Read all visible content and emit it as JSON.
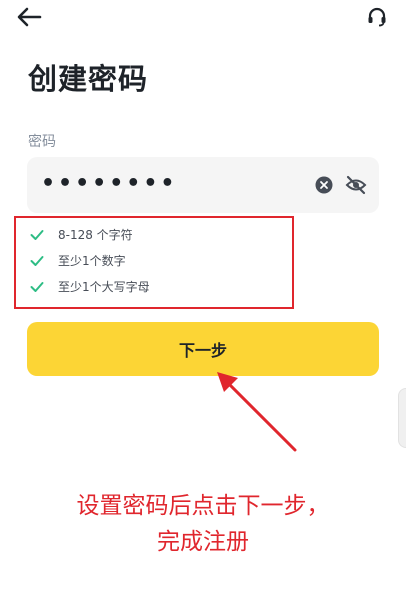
{
  "header": {
    "back_icon": "arrow-left-icon",
    "support_icon": "headset-icon"
  },
  "page": {
    "title": "创建密码"
  },
  "password_field": {
    "label": "密码",
    "value": "••••••••",
    "clear_icon": "clear-circle-icon",
    "visibility_icon": "eye-off-icon"
  },
  "requirements": [
    {
      "text": "8-128 个字符",
      "met": true
    },
    {
      "text": "至少1个数字",
      "met": true
    },
    {
      "text": "至少1个大写字母",
      "met": true
    }
  ],
  "next_button": {
    "label": "下一步"
  },
  "annotation": {
    "line1": "设置密码后点击下一步，",
    "line2": "完成注册",
    "color": "#e0262d"
  },
  "colors": {
    "accent": "#fcd535",
    "check": "#2ebd85",
    "highlight": "#e0262d"
  }
}
